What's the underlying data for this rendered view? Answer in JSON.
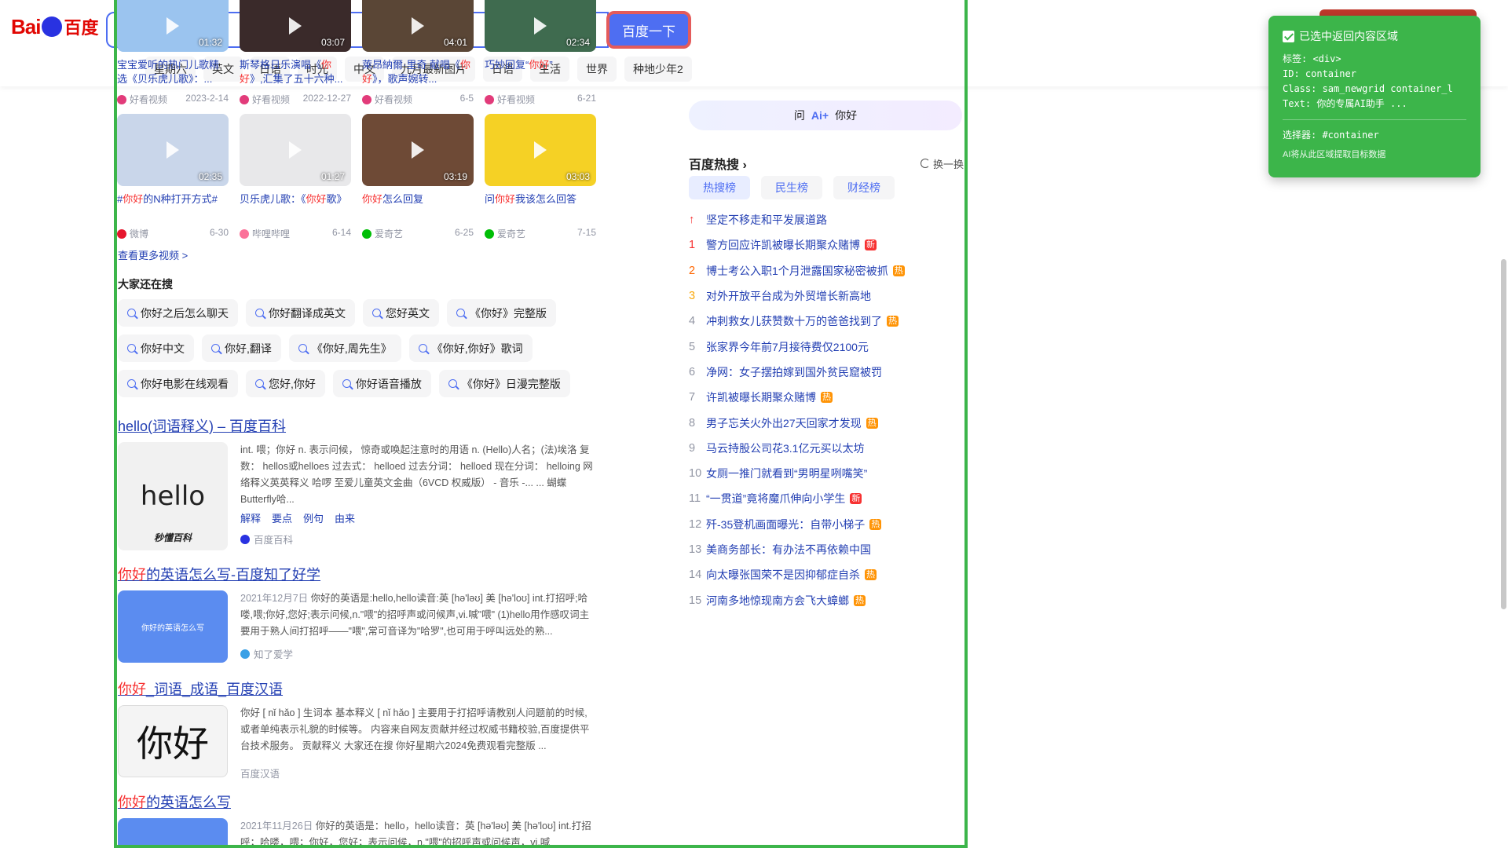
{
  "header": {
    "logo_bai": "Bai",
    "logo_du": "百度",
    "search_button": "百度一下",
    "tabs": [
      "星期六",
      "英文",
      "日语",
      "时光",
      "中文",
      "九月最新图片",
      "日语",
      "生活",
      "世界",
      "种地少年2"
    ]
  },
  "videos_row1": [
    {
      "title_pre": "宝宝爱听的热门儿歌精选《贝乐虎儿歌》：...",
      "title_hl": "",
      "title_post": "",
      "duration": "01:32",
      "source": "好看视频",
      "date": "2023-2-14",
      "thumb_color": "#9bc4ef"
    },
    {
      "title_pre": "斯琴格日乐演唱《",
      "title_hl": "你好",
      "title_post": "》,汇集了五十六种...",
      "duration": "03:07",
      "source": "好看视频",
      "date": "2022-12-27",
      "thumb_color": "#3a2a2a"
    },
    {
      "title_pre": "萊昂納爾·里奇 献唱《",
      "title_hl": "你好",
      "title_post": "》，歌声婉转...",
      "duration": "04:01",
      "source": "好看视频",
      "date": "6-5",
      "thumb_color": "#5a4636"
    },
    {
      "title_pre": "巧妙回复“",
      "title_hl": "你好",
      "title_post": "”",
      "duration": "02:34",
      "source": "好看视频",
      "date": "6-21",
      "thumb_color": "#3f6b4f"
    }
  ],
  "videos_row2": [
    {
      "title_pre": "#",
      "title_hl": "你好",
      "title_post": "的N种打开方式#",
      "duration": "02:35",
      "source": "微博",
      "date": "6-30",
      "thumb_color": "#c9d6ea",
      "src_color": "#e6162d"
    },
    {
      "title_pre": "贝乐虎儿歌：《",
      "title_hl": "你好",
      "title_post": "歌》",
      "duration": "01:27",
      "source": "哔哩哔哩",
      "date": "6-14",
      "thumb_color": "#e8e8ea",
      "src_color": "#fb7299"
    },
    {
      "title_pre": "",
      "title_hl": "你好",
      "title_post": "怎么回复",
      "duration": "03:19",
      "source": "爱奇艺",
      "date": "6-25",
      "thumb_color": "#6e4a36",
      "src_color": "#00be06"
    },
    {
      "title_pre": "问",
      "title_hl": "你好",
      "title_post": "我该怎么回答",
      "duration": "03:03",
      "source": "爱奇艺",
      "date": "7-15",
      "thumb_color": "#f5d125",
      "src_color": "#00be06"
    }
  ],
  "more_videos": "查看更多视频 >",
  "also_search": {
    "title": "大家还在搜",
    "items": [
      "你好之后怎么聊天",
      "你好翻译成英文",
      "您好英文",
      "《你好》完整版",
      "你好中文",
      "你好,翻译",
      "《你好,周先生》",
      "《你好,你好》歌词",
      "你好电影在线观看",
      "您好,你好",
      "你好语音播放",
      "《你好》日漫完整版"
    ]
  },
  "results": [
    {
      "title_pre": "hello(词语释义) – 百度百科",
      "title_hl": "",
      "title_post": "",
      "text": "int. 喂；你好 n. 表示问候， 惊奇或唤起注意时的用语 n. (Hello)人名；(法)埃洛 复数： hellos或helloes 过去式： helloed 过去分词： helloed 现在分词： helloing 网络释义英英释义 哈啰 至爱儿童英文金曲（6VCD 权威版） - 音乐 -... ... 蝴蝶Butterfly哈...",
      "links": [
        "解释",
        "要点",
        "例句",
        "由来"
      ],
      "source": "百度百科",
      "img_text": "hello",
      "img_sub": "秒懂百科"
    },
    {
      "title_pre": "",
      "title_hl": "你好",
      "title_post": "的英语怎么写-百度知了好学",
      "date": "2021年12月7日",
      "text": "你好的英语是:hello,hello读音:英 [hə'ləʊ] 美 [hə'loʊ] int.打招呼;哈喽,喂;你好,您好;表示问候,n.\"喂\"的招呼声或问候声,vi.喊\"喂\" (1)hello用作感叹词主要用于熟人间打招呼——\"喂\",常可音译为\"哈罗\",也可用于呼叫远处的熟...",
      "source": "知了爱学",
      "img_text": "你好的英语怎么写"
    },
    {
      "title_pre": "",
      "title_hl": "你好",
      "title_post": "_词语_成语_百度汉语",
      "text": "你好 [ nǐ hǎo ] 生词本 基本释义 [ nǐ hǎo ] 主要用于打招呼请教别人问题前的时候,或者单纯表示礼貌的时候等。 内容来自网友贡献并经过权威书籍校验,百度提供平台技术服务。 贡献释义 大家还在搜 你好星期六2024免费观看完整版 ...",
      "source": "百度汉语",
      "img_text": "你好"
    },
    {
      "title_pre": "",
      "title_hl": "你好",
      "title_post": "的英语怎么写",
      "date": "2021年11月26日",
      "text": "你好的英语是：hello，hello读音：英 [hə'ləʊ] 美 [hə'loʊ] int.打招呼；哈喽，喂；你好，您好；表示问候，n.\"喂\"的招呼声或问候声，vi.喊",
      "source": "",
      "img_text": ""
    }
  ],
  "ai_ask": {
    "prefix": "问",
    "brand": "Ai+",
    "query": "你好"
  },
  "hot": {
    "title": "百度热搜",
    "refresh": "换一换",
    "tabs": [
      "热搜榜",
      "民生榜",
      "财经榜"
    ],
    "items": [
      {
        "rank": "↑",
        "text": "坚定不移走和平发展道路",
        "badge": ""
      },
      {
        "rank": "1",
        "text": "警方回应许凯被曝长期聚众赌博",
        "badge": "新"
      },
      {
        "rank": "2",
        "text": "博士考公入职1个月泄露国家秘密被抓",
        "badge": "热"
      },
      {
        "rank": "3",
        "text": "对外开放平台成为外贸增长新高地",
        "badge": ""
      },
      {
        "rank": "4",
        "text": "冲刺救女儿获赞数十万的爸爸找到了",
        "badge": "热"
      },
      {
        "rank": "5",
        "text": "张家界今年前7月接待费仅2100元",
        "badge": ""
      },
      {
        "rank": "6",
        "text": "净网：女子摆拍嫁到国外贫民窟被罚",
        "badge": ""
      },
      {
        "rank": "7",
        "text": "许凯被曝长期聚众赌博",
        "badge": "热"
      },
      {
        "rank": "8",
        "text": "男子忘关火外出27天回家才发现",
        "badge": "热"
      },
      {
        "rank": "9",
        "text": "马云持股公司花3.1亿元买以太坊",
        "badge": ""
      },
      {
        "rank": "10",
        "text": "女厕一推门就看到“男明星咧嘴笑”",
        "badge": ""
      },
      {
        "rank": "11",
        "text": "“一贯道”竟将魔爪伸向小学生",
        "badge": "新"
      },
      {
        "rank": "12",
        "text": "歼-35登机画面曝光：自带小梯子",
        "badge": "热"
      },
      {
        "rank": "13",
        "text": "美商务部长：有办法不再依赖中国",
        "badge": ""
      },
      {
        "rank": "14",
        "text": "向太曝张国荣不是因抑郁症自杀",
        "badge": "热"
      },
      {
        "rank": "15",
        "text": "河南多地惊现南方会飞大蟑螂",
        "badge": "热"
      }
    ]
  },
  "overlay": {
    "title": "已选中返回内容区域",
    "lines": [
      "标签: <div>",
      "ID: container",
      "Class: sam_newgrid container_l",
      "Text: 你的专属AI助手 ..."
    ],
    "selector": "选择器: #container",
    "hint": "AI将从此区域提取目标数据"
  },
  "colors": {
    "accent": "#4e6ef2",
    "highlight": "#f73131",
    "selection": "#3cb54a"
  }
}
